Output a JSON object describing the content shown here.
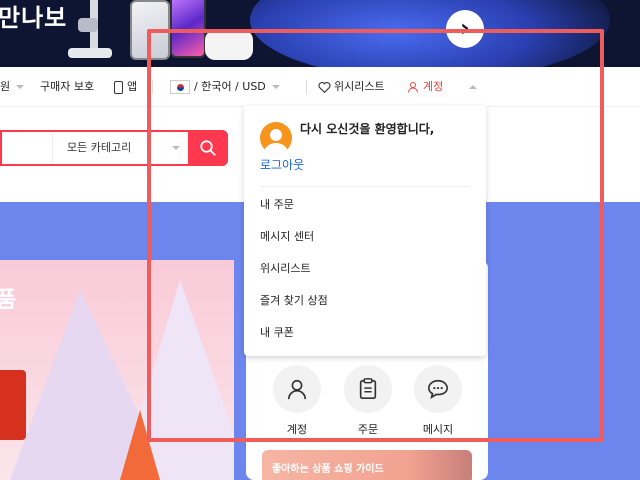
{
  "banner": {
    "title": "만나보",
    "next_glyph": "›"
  },
  "nav": {
    "item_left_partial": "원",
    "buyer_protection": "구매자 보호",
    "app": "앱",
    "locale": "/ 한국어 / USD",
    "wishlist": "위시리스트",
    "account": "계정"
  },
  "search": {
    "category": "모든 카테고리"
  },
  "hero": {
    "title_partial": "품"
  },
  "dropdown": {
    "welcome": "다시 오신것을 환영합니다,",
    "logout": "로그아웃",
    "items": [
      "내 주문",
      "메시지 센터",
      "위시리스트",
      "즐겨 찾기 상점",
      "내 쿠폰"
    ]
  },
  "card": {
    "quick_links": [
      "계정",
      "주문",
      "메시지"
    ],
    "promo": "좋아하는 상품 쇼핑 가이드"
  },
  "colors": {
    "accent": "#fd384f",
    "link": "#1a66d1",
    "avatar": "#f7941d",
    "highlight": "#ee5c5c",
    "page_bg": "#6d86ee"
  }
}
